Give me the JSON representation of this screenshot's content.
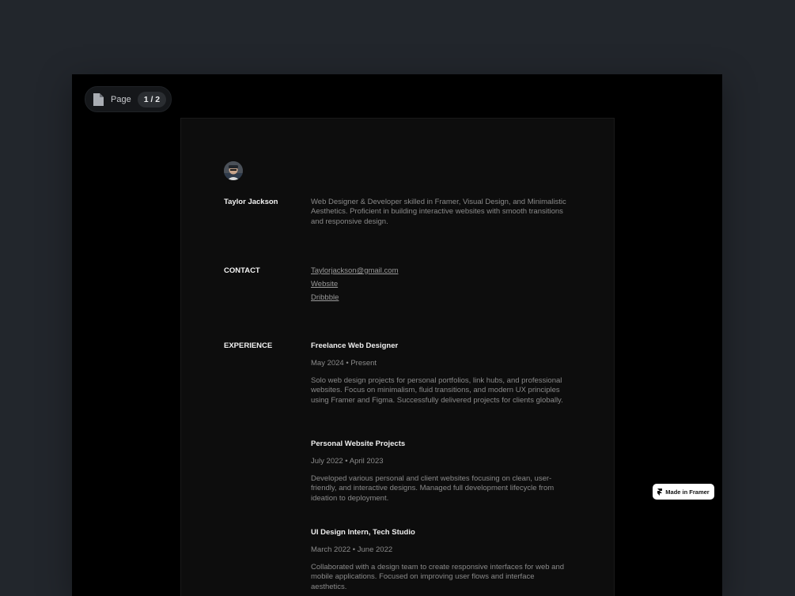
{
  "pager": {
    "label": "Page",
    "count": "1 / 2"
  },
  "profile": {
    "name": "Taylor Jackson",
    "bio": "Web Designer & Developer skilled in Framer, Visual Design, and Minimalistic Aesthetics. Proficient in building interactive websites with smooth transitions and responsive design."
  },
  "contact": {
    "label": "CONTACT",
    "email": "Taylorjackson@gmail.com",
    "website": "Website",
    "dribbble": "Dribbble"
  },
  "experience": {
    "label": "EXPERIENCE",
    "jobs": [
      {
        "title": "Freelance Web Designer",
        "dates": "May 2024 • Present",
        "description": "Solo web design projects for personal portfolios, link hubs, and professional websites. Focus on minimalism, fluid transitions, and modern UX principles using Framer and Figma. Successfully delivered projects for clients globally."
      },
      {
        "title": "Personal Website Projects",
        "dates": "July 2022 • April 2023",
        "description": "Developed various personal and client websites focusing on clean, user-friendly, and interactive designs. Managed full development lifecycle from ideation to deployment."
      },
      {
        "title": "UI Design Intern, Tech Studio",
        "dates": "March 2022 • June 2022",
        "description": "Collaborated with a design team to create responsive interfaces for web and mobile applications. Focused on improving user flows and interface aesthetics."
      }
    ]
  },
  "badge": {
    "label": "Made in Framer"
  },
  "icons": {
    "pager": "document-icon",
    "badge": "framer-logo-icon"
  }
}
